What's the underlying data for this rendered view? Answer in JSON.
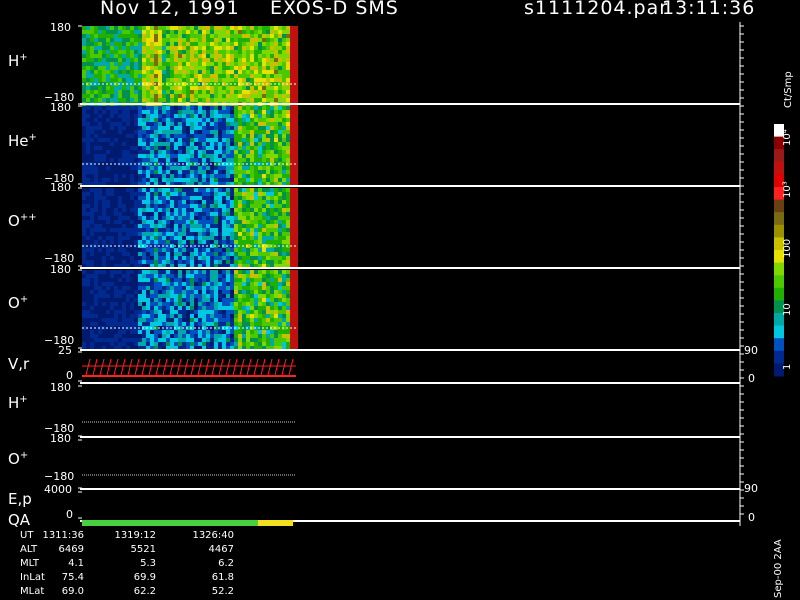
{
  "header": {
    "date": "Nov 12, 1991",
    "instrument": "EXOS-D SMS",
    "file": "s1111204.par",
    "time": "13:11:36"
  },
  "panels": [
    {
      "label": "H",
      "sup": "+",
      "top": "180",
      "bottom": "−180"
    },
    {
      "label": "He",
      "sup": "+",
      "top": "180",
      "bottom": "−180"
    },
    {
      "label": "O",
      "sup": "++",
      "top": "180",
      "bottom": "−180"
    },
    {
      "label": "O",
      "sup": "+",
      "top": "180",
      "bottom": "−180"
    }
  ],
  "vr": {
    "label": "V,r",
    "top": "25",
    "bottom": "0",
    "rtop": "90",
    "rbottom": "0"
  },
  "lower": [
    {
      "label": "H",
      "sup": "+",
      "top": "180",
      "bottom": "−180"
    },
    {
      "label": "O",
      "sup": "+",
      "top": "180",
      "bottom": "−180"
    }
  ],
  "ep": {
    "label": "E,p",
    "top": "4000",
    "bottom": "0",
    "rtop": "90",
    "rbottom": "0"
  },
  "qa": {
    "label": "QA"
  },
  "colorbar": {
    "unit": "Ct/Smp",
    "labels": [
      "10⁴",
      "10³",
      "100",
      "10",
      "1"
    ],
    "colors": [
      "#ffffff",
      "#8b0000",
      "#9a1a1a",
      "#c01010",
      "#e00000",
      "#ff2020",
      "#6b4010",
      "#7a6a10",
      "#9a9000",
      "#c8c000",
      "#e8e000",
      "#7fd800",
      "#4cc800",
      "#20b000",
      "#009050",
      "#00a8a8",
      "#00c8e0",
      "#0050c0",
      "#002a90",
      "#001a70"
    ]
  },
  "footer": {
    "rows": [
      {
        "name": "UT",
        "values": [
          "1311:36",
          "1319:12",
          "1326:40"
        ]
      },
      {
        "name": "ALT",
        "values": [
          "6469",
          "5521",
          "4467"
        ]
      },
      {
        "name": "MLT",
        "values": [
          "4.1",
          "5.3",
          "6.2"
        ]
      },
      {
        "name": "InLat",
        "values": [
          "75.4",
          "69.9",
          "61.8"
        ]
      },
      {
        "name": "MLat",
        "values": [
          "69.0",
          "62.2",
          "52.2"
        ]
      }
    ],
    "version": "Sep-00 2AA"
  },
  "chart_data": {
    "type": "heatmap",
    "title": "Nov 12, 1991 EXOS-D SMS s1111204.par 13:11:36",
    "x_ticks": [
      "1311:36",
      "1319:12",
      "1326:40"
    ],
    "panels": [
      "H+",
      "He+",
      "O++",
      "O+"
    ],
    "y_range": [
      -180,
      180
    ],
    "colorbar_unit": "Ct/Smp",
    "colorbar_ticks": [
      "1",
      "10",
      "100",
      "10³",
      "10⁴"
    ],
    "qa_segments": [
      {
        "from": "1311:36",
        "to": "1326:40",
        "color": "#48d040"
      },
      {
        "to_end": true,
        "color": "#f0e020"
      }
    ]
  }
}
